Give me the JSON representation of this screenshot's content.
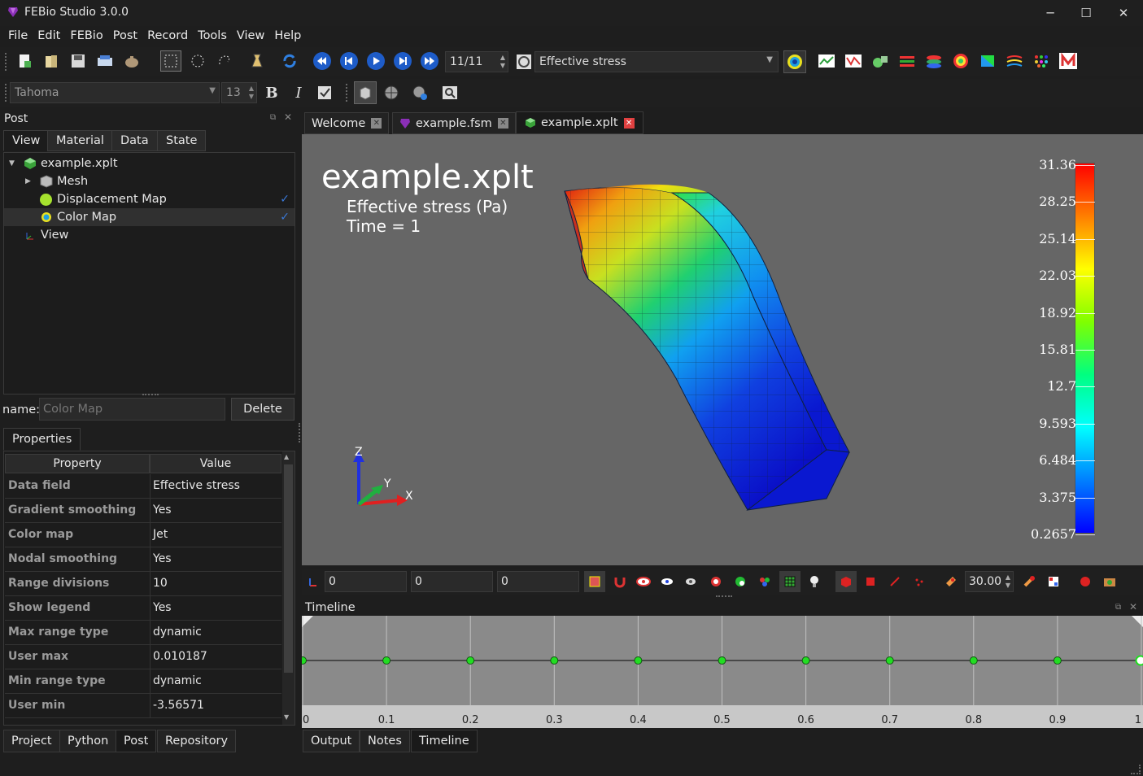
{
  "window": {
    "title": "FEBio Studio 3.0.0",
    "minimize": "─",
    "maximize": "☐",
    "close": "✕"
  },
  "menu": [
    "File",
    "Edit",
    "FEBio",
    "Post",
    "Record",
    "Tools",
    "View",
    "Help"
  ],
  "toolbar": {
    "frame": "11/11",
    "data_field": "Effective stress"
  },
  "fontbar": {
    "font": "Tahoma",
    "size": "13",
    "bold": "B",
    "italic": "I"
  },
  "post_panel": {
    "label": "Post",
    "tabs": [
      "View",
      "Material",
      "Data",
      "State"
    ],
    "tree": [
      {
        "label": "example.xplt",
        "icon": "model-icon",
        "checked": false
      },
      {
        "label": "Mesh",
        "icon": "mesh-icon",
        "checked": false
      },
      {
        "label": "Displacement Map",
        "icon": "displacement-icon",
        "checked": true
      },
      {
        "label": "Color Map",
        "icon": "colormap-icon",
        "checked": true
      },
      {
        "label": "View",
        "icon": "axes-icon",
        "checked": false
      }
    ],
    "name_label": "name:",
    "name_placeholder": "Color Map",
    "delete_label": "Delete",
    "properties_tab": "Properties",
    "columns": [
      "Property",
      "Value"
    ],
    "properties": [
      {
        "name": "Data field",
        "value": "Effective stress"
      },
      {
        "name": "Gradient smoothing",
        "value": "Yes"
      },
      {
        "name": "Color map",
        "value": "Jet"
      },
      {
        "name": "Nodal smoothing",
        "value": "Yes"
      },
      {
        "name": "Range divisions",
        "value": "10"
      },
      {
        "name": "Show legend",
        "value": "Yes"
      },
      {
        "name": "Max range type",
        "value": "dynamic"
      },
      {
        "name": "User max",
        "value": "0.010187"
      },
      {
        "name": "Min range type",
        "value": "dynamic"
      },
      {
        "name": "User min",
        "value": "-3.56571"
      }
    ]
  },
  "left_bottom_tabs": [
    "Project",
    "Python",
    "Post",
    "Repository"
  ],
  "doc_tabs": [
    {
      "label": "Welcome",
      "icon": ""
    },
    {
      "label": "example.fsm",
      "icon": "fsm-icon"
    },
    {
      "label": "example.xplt",
      "icon": "xplt-icon"
    }
  ],
  "viewport": {
    "title": "example.xplt",
    "subtitle": "Effective stress (Pa)",
    "time": "Time = 1",
    "legend": [
      "31.36",
      "28.25",
      "25.14",
      "22.03",
      "18.92",
      "15.81",
      "12.7",
      "9.593",
      "6.484",
      "3.375",
      "0.2657"
    ],
    "axes": {
      "x": "X",
      "y": "Y",
      "z": "Z"
    }
  },
  "viewbar": {
    "x": "0",
    "y": "0",
    "z": "0",
    "angle": "30.00"
  },
  "timeline": {
    "label": "Timeline",
    "ticks": [
      "0",
      "0.1",
      "0.2",
      "0.3",
      "0.4",
      "0.5",
      "0.6",
      "0.7",
      "0.8",
      "0.9",
      "1"
    ]
  },
  "right_bottom_tabs": [
    "Output",
    "Notes",
    "Timeline"
  ],
  "colors": {
    "accent": "#3a78d6",
    "viewport_bg": "#666666",
    "timeline_bg": "#8a8a8a",
    "keyframe": "#22dd22"
  }
}
